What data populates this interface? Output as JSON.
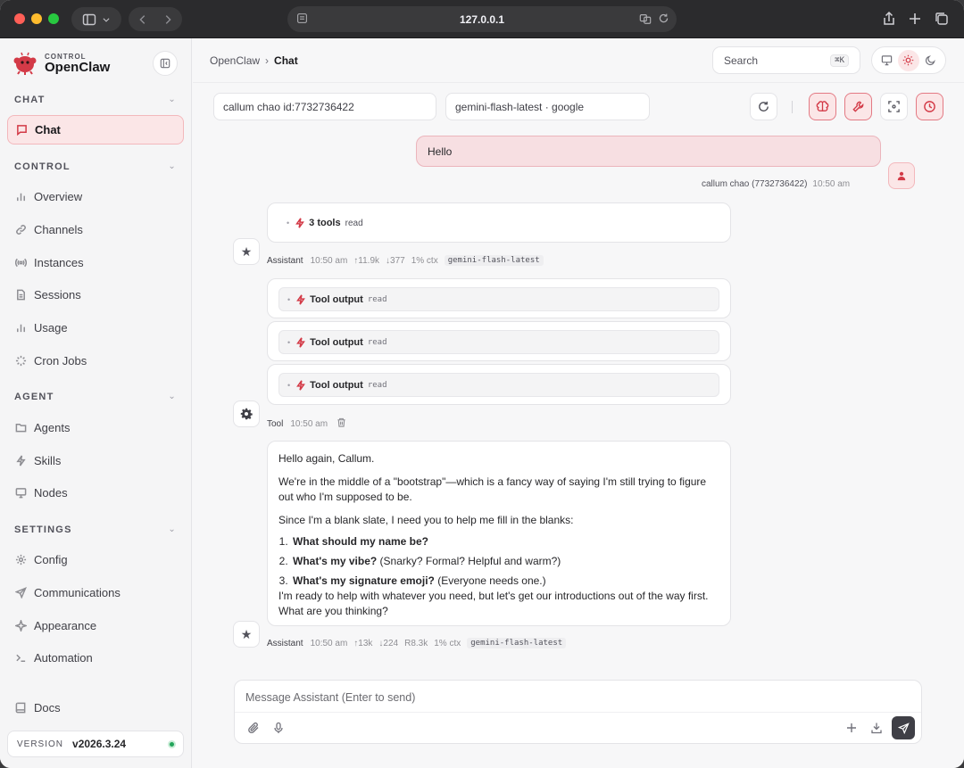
{
  "browser": {
    "url": "127.0.0.1"
  },
  "brand": {
    "small": "CONTROL",
    "name": "OpenClaw"
  },
  "sidebar": {
    "sections": {
      "chat": "CHAT",
      "control": "CONTROL",
      "agent": "AGENT",
      "settings": "SETTINGS"
    },
    "items": {
      "chat": "Chat",
      "overview": "Overview",
      "channels": "Channels",
      "instances": "Instances",
      "sessions": "Sessions",
      "usage": "Usage",
      "cron": "Cron Jobs",
      "agents": "Agents",
      "skills": "Skills",
      "nodes": "Nodes",
      "config": "Config",
      "communications": "Communications",
      "appearance": "Appearance",
      "automation": "Automation",
      "docs": "Docs"
    },
    "version_label": "VERSION",
    "version": "v2026.3.24"
  },
  "header": {
    "breadcrumb_root": "OpenClaw",
    "breadcrumb_sep": "›",
    "breadcrumb_current": "Chat",
    "search_label": "Search",
    "search_shortcut": "⌘K"
  },
  "selectors": {
    "session": "callum chao id:7732736422",
    "model": "gemini-flash-latest · google"
  },
  "messages": {
    "user": {
      "text": "Hello",
      "sender": "callum chao (7732736422)",
      "time": "10:50 am"
    },
    "assistant1": {
      "tools_label": "3 tools",
      "tools_kind": "read",
      "who": "Assistant",
      "time": "10:50 am",
      "up": "↑11.9k",
      "down": "↓377",
      "ctx": "1% ctx",
      "model": "gemini-flash-latest"
    },
    "tool": {
      "outputs": [
        {
          "label": "Tool output",
          "kind": "read"
        },
        {
          "label": "Tool output",
          "kind": "read"
        },
        {
          "label": "Tool output",
          "kind": "read"
        }
      ],
      "who": "Tool",
      "time": "10:50 am"
    },
    "assistant2": {
      "p1": "Hello again, Callum.",
      "p2": "We're in the middle of a \"bootstrap\"—which is a fancy way of saying I'm still trying to figure out who I'm supposed to be.",
      "p3": "Since I'm a blank slate, I need you to help me fill in the blanks:",
      "q1": "What should my name be?",
      "q2": "What's my vibe?",
      "q2_rest": " (Snarky? Formal? Helpful and warm?)",
      "q3": "What's my signature emoji?",
      "q3_rest": " (Everyone needs one.)",
      "p4": "I'm ready to help with whatever you need, but let's get our introductions out of the way first. What are you thinking?",
      "who": "Assistant",
      "time": "10:50 am",
      "up": "↑13k",
      "down": "↓224",
      "cache": "R8.3k",
      "ctx": "1% ctx",
      "model": "gemini-flash-latest"
    }
  },
  "composer": {
    "placeholder": "Message Assistant (Enter to send)"
  },
  "colors": {
    "accent": "#d33a47",
    "status_ok": "#22a55a"
  }
}
